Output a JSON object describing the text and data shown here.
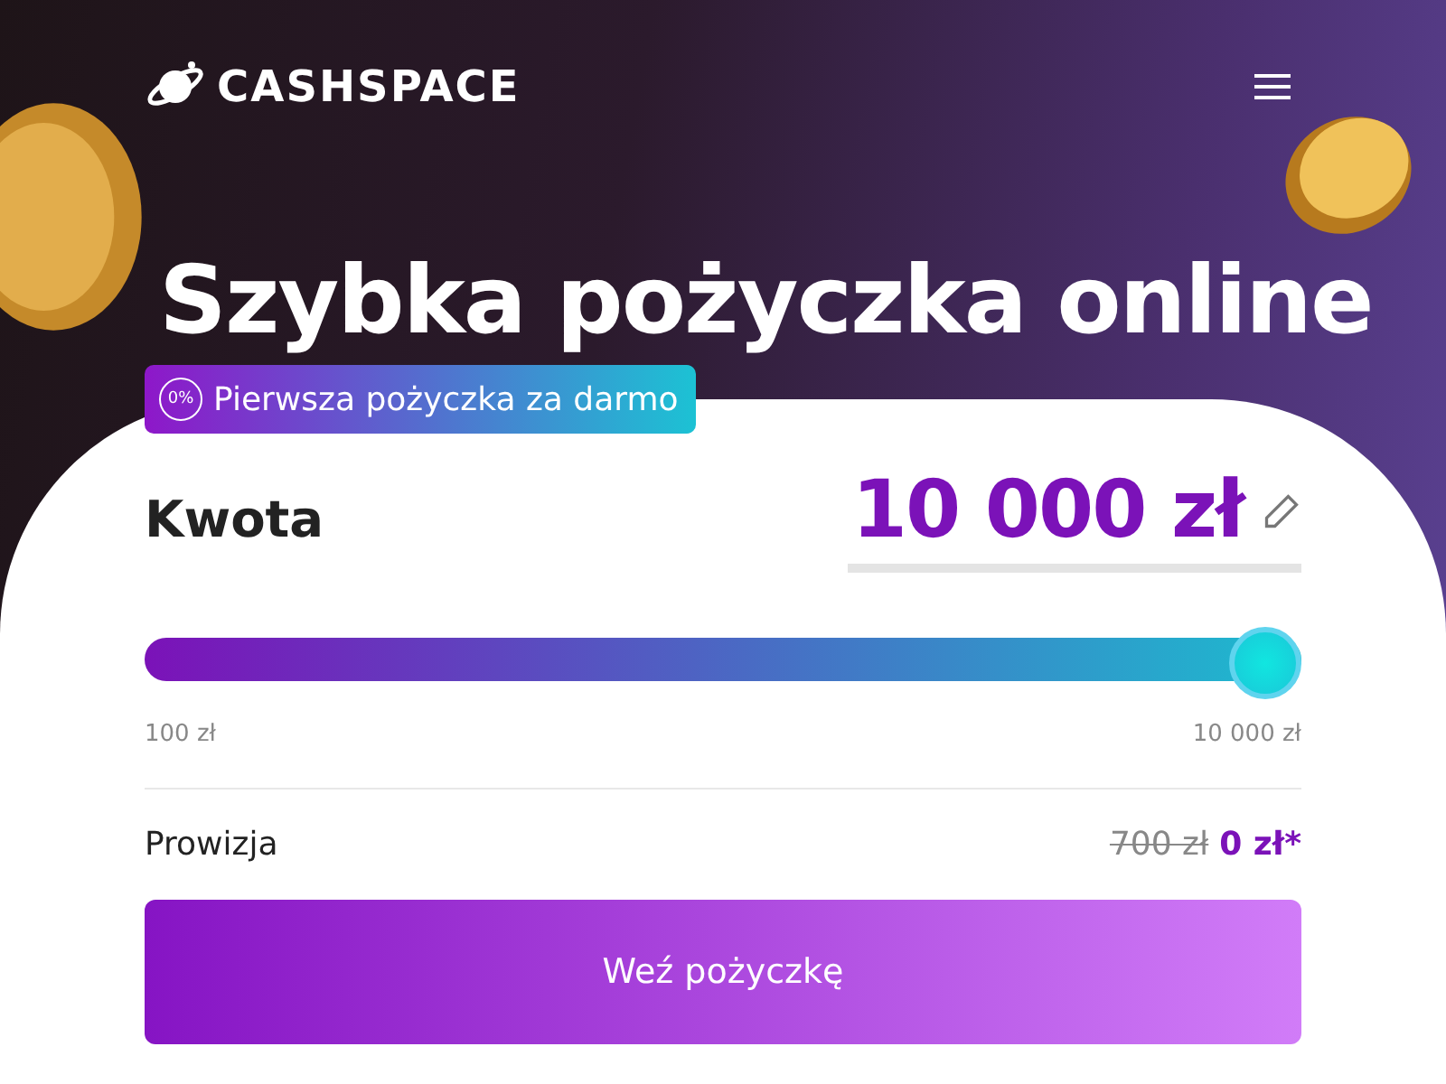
{
  "header": {
    "logo": "CASHSPACE"
  },
  "hero": {
    "title": "Szybka pożyczka online",
    "badge": {
      "icon_text": "0%",
      "label": "Pierwsza pożyczka za darmo"
    }
  },
  "amount": {
    "label": "Kwota",
    "value": "10 000 zł",
    "slider": {
      "level": 1,
      "min_label": "100 zł",
      "max_label": "10 000 zł"
    }
  },
  "fee": {
    "label": "Prowizja",
    "old_value": "700 zł",
    "new_value": "0 zł*"
  },
  "submit": {
    "label": "Weź pożyczkę"
  }
}
